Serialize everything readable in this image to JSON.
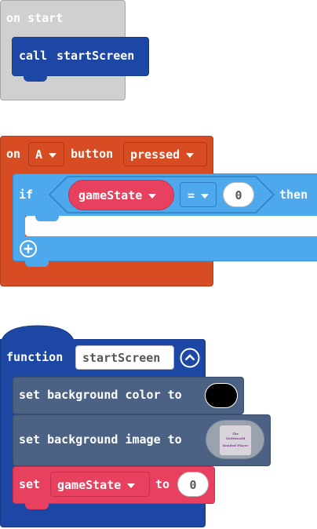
{
  "on_start": {
    "header": "on start",
    "call_label": "call",
    "call_target": "startScreen"
  },
  "on_button": {
    "on_label": "on",
    "button_name": "A",
    "button_word": "button",
    "event": "pressed",
    "if_label": "if",
    "variable": "gameState",
    "operator": "=",
    "compare_value": "0",
    "then_label": "then"
  },
  "function_block": {
    "keyword": "function",
    "name": "startScreen",
    "set_bg_color_label": "set background color to",
    "bg_color": "#000000",
    "set_bg_image_label": "set background image to",
    "image_text_line1": "The",
    "image_text_line2": "Multiworld",
    "image_text_line3": "Bonded Player",
    "set_label": "set",
    "set_variable": "gameState",
    "to_label": "to",
    "set_value": "0"
  },
  "colors": {
    "event_gray": "#d0d0d0",
    "function_blue": "#1c47a4",
    "event_red": "#d84c24",
    "logic_blue": "#4ea9ec",
    "variable_red": "#e8405f",
    "scene_slate": "#4c6285"
  }
}
